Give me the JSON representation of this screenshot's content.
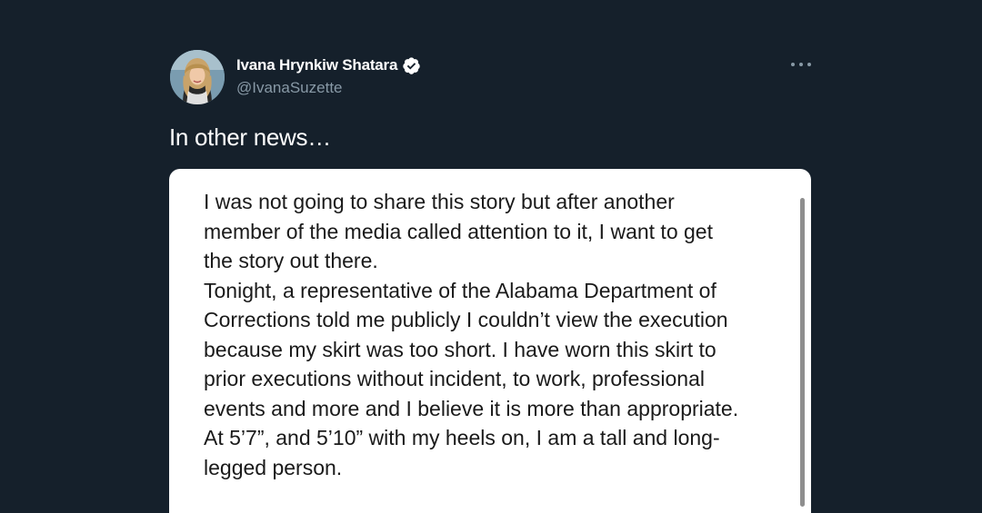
{
  "author": {
    "display_name": "Ivana Hrynkiw Shatara",
    "handle": "@IvanaSuzette",
    "verified": true
  },
  "icons": {
    "avatar": "profile-photo",
    "verified": "verified-badge-icon",
    "more": "more-options-icon"
  },
  "tweet": {
    "text": "In other news…"
  },
  "media": {
    "statement_lines": [
      "I was not going to share this story but after another",
      "member of the media called attention to it, I want to get",
      "the story out there.",
      "Tonight, a representative of the Alabama Department of",
      "Corrections told me publicly I couldn’t view the execution",
      "because my skirt was too short. I have worn this skirt to",
      "prior executions without incident, to work, professional",
      "events and more and I believe it is more than appropriate.",
      "At 5’7”, and 5’10” with my heels on, I am a tall and long-",
      "legged person."
    ]
  },
  "colors": {
    "background": "#15202b",
    "name_text": "#ffffff",
    "secondary_text": "#8899a6",
    "verified_badge": "#ffffff",
    "card_background": "#ffffff",
    "card_text": "#1a1a1a"
  }
}
